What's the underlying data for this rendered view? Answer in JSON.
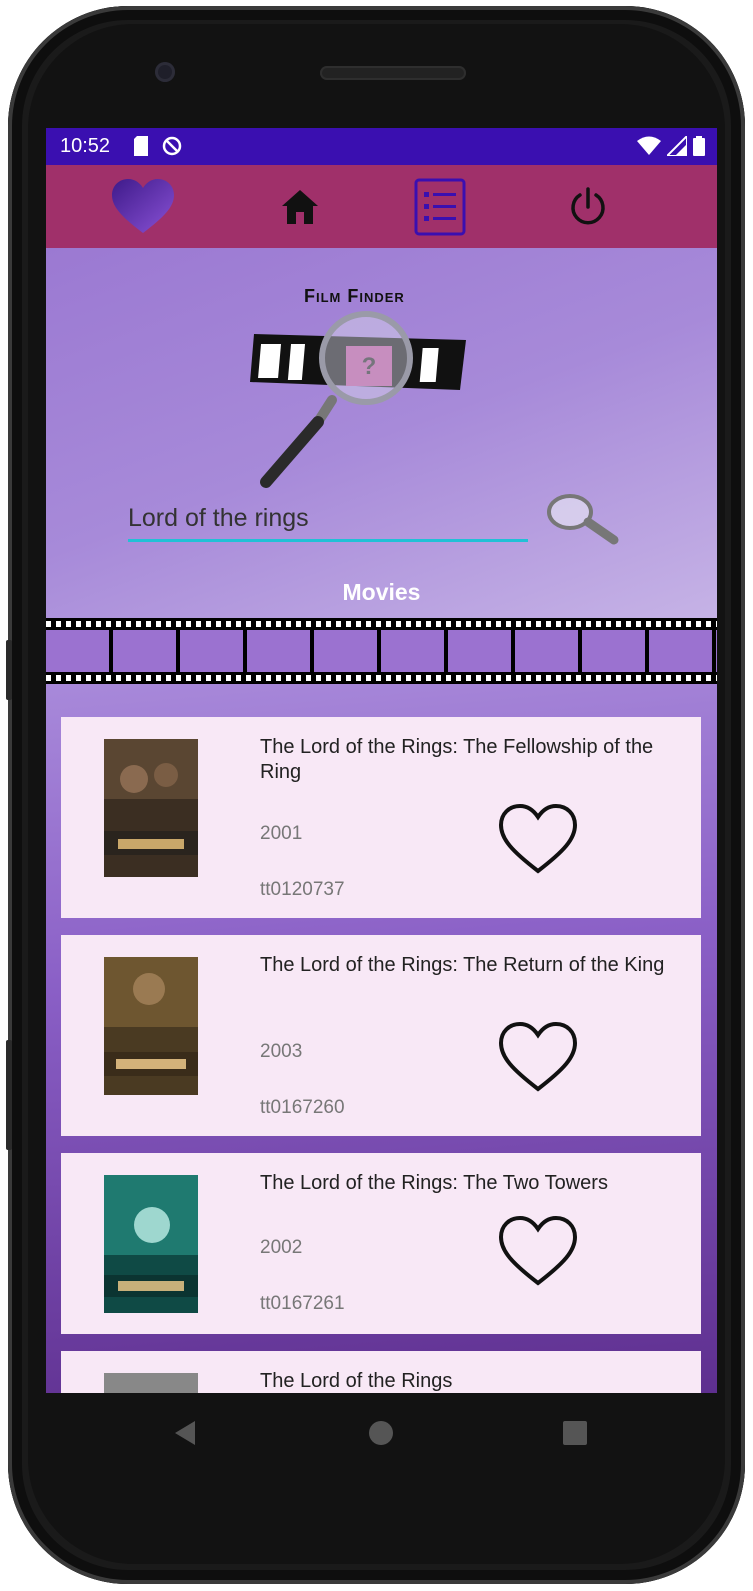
{
  "status_bar": {
    "time": "10:52",
    "icons_left": [
      "sd-card-icon",
      "do-not-disturb-icon"
    ],
    "icons_right": [
      "wifi-icon",
      "signal-icon",
      "battery-icon"
    ]
  },
  "toolbar": {
    "items": [
      {
        "name": "favorites",
        "icon": "heart-icon"
      },
      {
        "name": "home",
        "icon": "home-icon"
      },
      {
        "name": "list",
        "icon": "list-icon"
      },
      {
        "name": "logout",
        "icon": "power-icon"
      }
    ]
  },
  "header": {
    "logo_title": "Film Finder",
    "logo_badge": "?"
  },
  "search": {
    "value": "Lord of the rings",
    "placeholder": ""
  },
  "section_label": "Movies",
  "movies": [
    {
      "title": "The Lord of the Rings: The Fellowship of the Ring",
      "year": "2001",
      "id": "tt0120737",
      "poster_color": "#4a3a2a"
    },
    {
      "title": "The Lord of the Rings: The Return of the King",
      "year": "2003",
      "id": "tt0167260",
      "poster_color": "#5a4628"
    },
    {
      "title": "The Lord of the Rings: The Two Towers",
      "year": "2002",
      "id": "tt0167261",
      "poster_color": "#1f6d66"
    },
    {
      "title": "The Lord of the Rings",
      "year": "",
      "id": "",
      "poster_color": "#777777"
    }
  ],
  "colors": {
    "status_bar": "#3a0fb0",
    "toolbar": "#a0306a",
    "search_underline": "#21c0d6",
    "card_bg": "#f8e8f6"
  },
  "nav": {
    "back": "back-icon",
    "home": "home-circle-icon",
    "recents": "recents-icon"
  }
}
